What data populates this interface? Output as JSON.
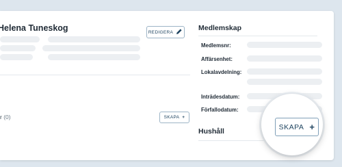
{
  "person": {
    "name": "Helena Tuneskog",
    "edit_label": "REDIGERA"
  },
  "household_count": {
    "label": "r",
    "count": "(0)",
    "create_label": "SKAPA"
  },
  "membership": {
    "title": "Medlemskap",
    "fields": [
      {
        "label": "Medlemsnr:"
      },
      {
        "label": "Affärsenhet:"
      },
      {
        "label": "Lokalavdelning:"
      },
      {
        "label": "Inträdesdatum:"
      },
      {
        "label": "Förfallodatum:"
      }
    ]
  },
  "household": {
    "title": "Hushåll",
    "create_label": "SKAPA"
  },
  "colors": {
    "accent": "#1f4460",
    "placeholder": "#eceff2",
    "background": "#dde6ee"
  },
  "icons": {
    "edit": "pencil-icon",
    "create": "plus-icon"
  }
}
